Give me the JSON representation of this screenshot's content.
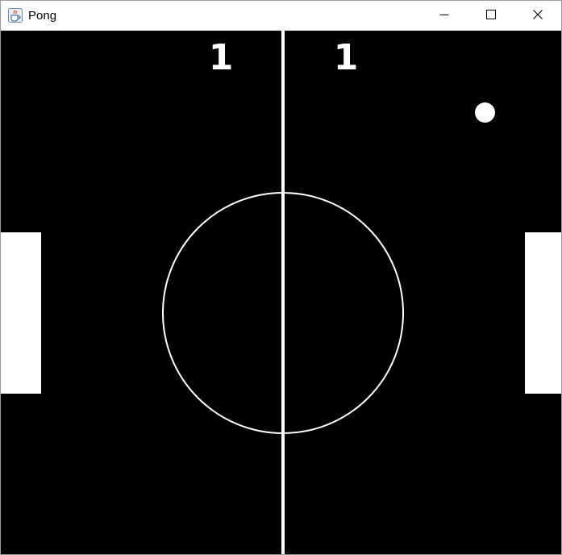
{
  "window": {
    "title": "Pong",
    "app_icon": "java-cup-icon",
    "controls": [
      "minimize-icon",
      "maximize-icon",
      "close-icon"
    ]
  },
  "game": {
    "background_color": "#000000",
    "foreground_color": "#ffffff",
    "score_left": "1",
    "score_right": "1"
  }
}
